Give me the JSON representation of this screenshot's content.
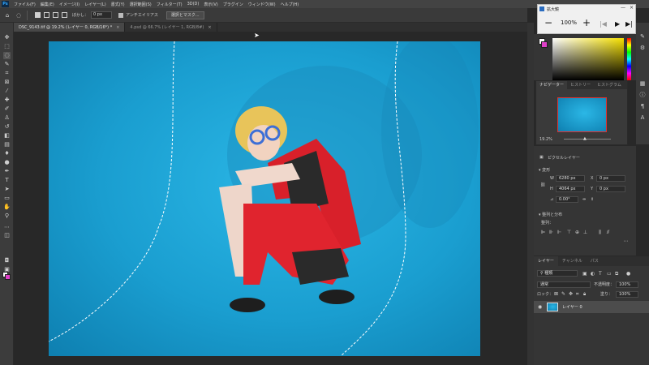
{
  "menu": {
    "logo": "Ps",
    "items": [
      "ファイル(F)",
      "編集(E)",
      "イメージ(I)",
      "レイヤー(L)",
      "書式(Y)",
      "選択範囲(S)",
      "フィルター(T)",
      "3D(D)",
      "表示(V)",
      "プラグイン",
      "ウィンドウ(W)",
      "ヘルプ(H)"
    ]
  },
  "options": {
    "feather_label": "ぼかし：",
    "feather_value": "0 px",
    "antialias_label": "アンチエイリアス",
    "select_mask_button": "選択とマスク..."
  },
  "tabs": [
    {
      "label": "DSC_9143.tif @ 19.2% (レイヤー 0, RGB/16*) *",
      "close": "×"
    },
    {
      "label": "4.psd @ 66.7% (レイヤー 1, RGB/8#)",
      "close": "×"
    }
  ],
  "magnifier": {
    "title": "拡大鏡",
    "minus": "−",
    "zoom": "100%",
    "plus": "+",
    "prev": "|◀",
    "play": "▶",
    "next": "▶|",
    "min": "—",
    "close": "×"
  },
  "navigator": {
    "tabs": [
      "ナビゲーター",
      "ヒストリー",
      "ヒストグラム"
    ],
    "zoom": "19.2%"
  },
  "properties": {
    "layer_type": "ピクセルレイヤー",
    "transform_header": "変形",
    "w_label": "W",
    "w_value": "6280 px",
    "x_label": "X",
    "x_value": "0 px",
    "h_label": "H",
    "h_value": "4064 px",
    "y_label": "Y",
    "y_value": "0 px",
    "angle_value": "0.00°",
    "align_header": "整列と分布",
    "align_sub": "整列："
  },
  "layers": {
    "tabs": [
      "レイヤー",
      "チャンネル",
      "パス"
    ],
    "filter": "種類",
    "blend_mode": "通常",
    "opacity_label": "不透明度：",
    "opacity_value": "100%",
    "lock_label": "ロック：",
    "fill_label": "塗り：",
    "fill_value": "100%",
    "layer_name": "レイヤー 0"
  },
  "colors": {
    "foreground": "#ffffff",
    "background": "#e040c8",
    "canvas_bg": "#1a9ed0"
  }
}
